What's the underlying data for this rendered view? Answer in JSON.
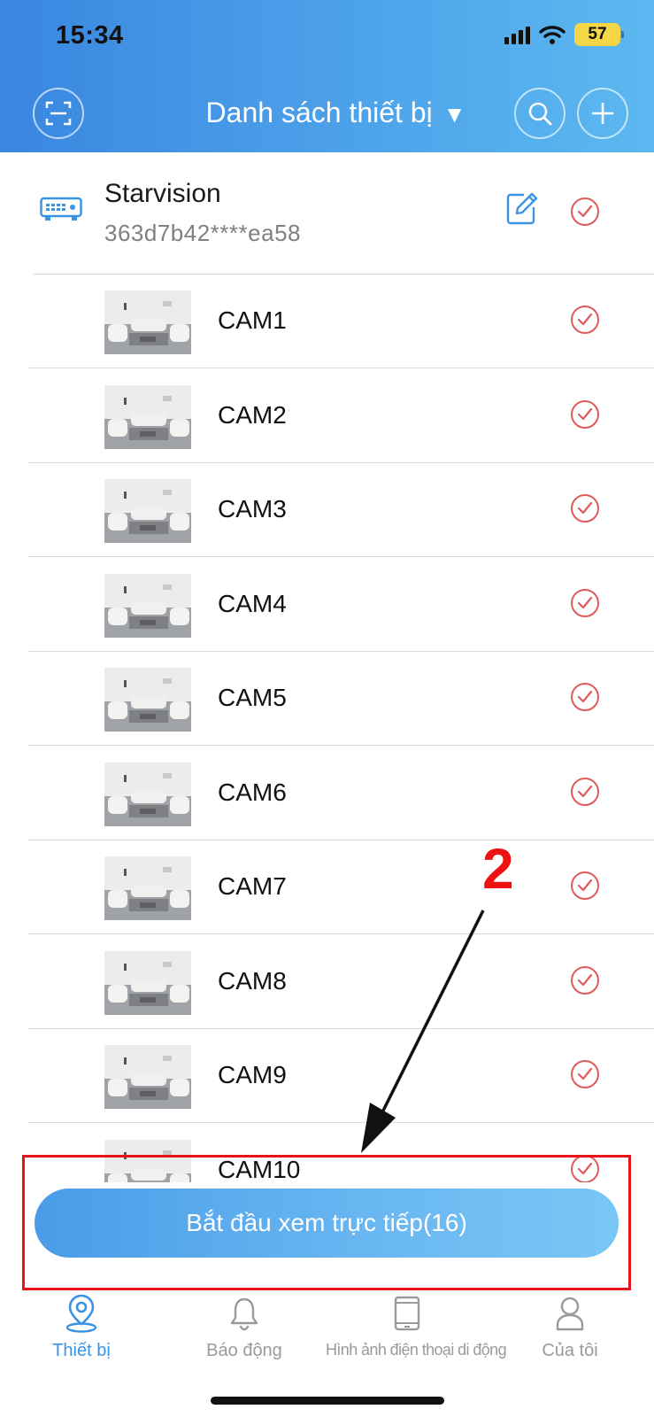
{
  "status_bar": {
    "time": "15:34",
    "battery": "57"
  },
  "nav": {
    "title": "Danh sách thiết bị",
    "caret": "▼"
  },
  "device": {
    "name": "Starvision",
    "serial": "363d7b42****ea58"
  },
  "cameras": [
    "CAM1",
    "CAM2",
    "CAM3",
    "CAM4",
    "CAM5",
    "CAM6",
    "CAM7",
    "CAM8",
    "CAM9",
    "CAM10"
  ],
  "start_button": {
    "label": "Bắt đầu xem trực tiếp(16)"
  },
  "annotation": {
    "number": "2"
  },
  "tabs": [
    {
      "label": "Thiết bị",
      "icon": "location-pin-icon",
      "active": true
    },
    {
      "label": "Báo động",
      "icon": "bell-icon",
      "active": false
    },
    {
      "label": "Hình ảnh điện thoại di động",
      "icon": "tablet-icon",
      "active": false
    },
    {
      "label": "Của tôi",
      "icon": "user-icon",
      "active": false
    }
  ],
  "colors": {
    "header_start": "#3a86e0",
    "header_end": "#5cb8f0",
    "check_red": "#e05a5a",
    "active_tab": "#3b93e6",
    "annotation_red": "#ee1111"
  }
}
